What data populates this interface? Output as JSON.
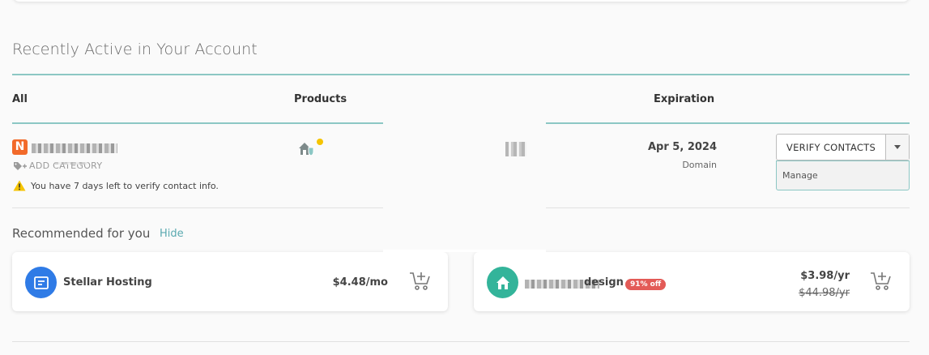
{
  "section": {
    "title": "Recently Active in Your Account"
  },
  "columns": {
    "all": "All",
    "products": "Products",
    "expiration": "Expiration"
  },
  "account_row": {
    "add_category": "ADD CATEGORY",
    "warning": "You have 7 days left to verify contact info.",
    "expiration_date": "Apr 5, 2024",
    "expiration_type": "Domain",
    "action_label": "VERIFY CONTACTS",
    "dropdown_option": "Manage",
    "brand_icon_letter": "N",
    "status_dot_color": "#f5c400"
  },
  "recommended": {
    "title": "Recommended for you",
    "hide": "Hide",
    "cards": [
      {
        "name": "Stellar Hosting",
        "price": "$4.48/mo",
        "icon": "hosting-icon",
        "icon_color": "#2f7be6"
      },
      {
        "name_suffix": "design",
        "badge": "91% off",
        "price": "$3.98/yr",
        "old_price": "$44.98/yr",
        "icon": "home-icon",
        "icon_color": "#33b49a"
      }
    ]
  },
  "colors": {
    "accent_rule": "#8cc7c4",
    "link": "#5aa9b0",
    "badge": "#e35b57",
    "brand": "#f26a2a"
  }
}
